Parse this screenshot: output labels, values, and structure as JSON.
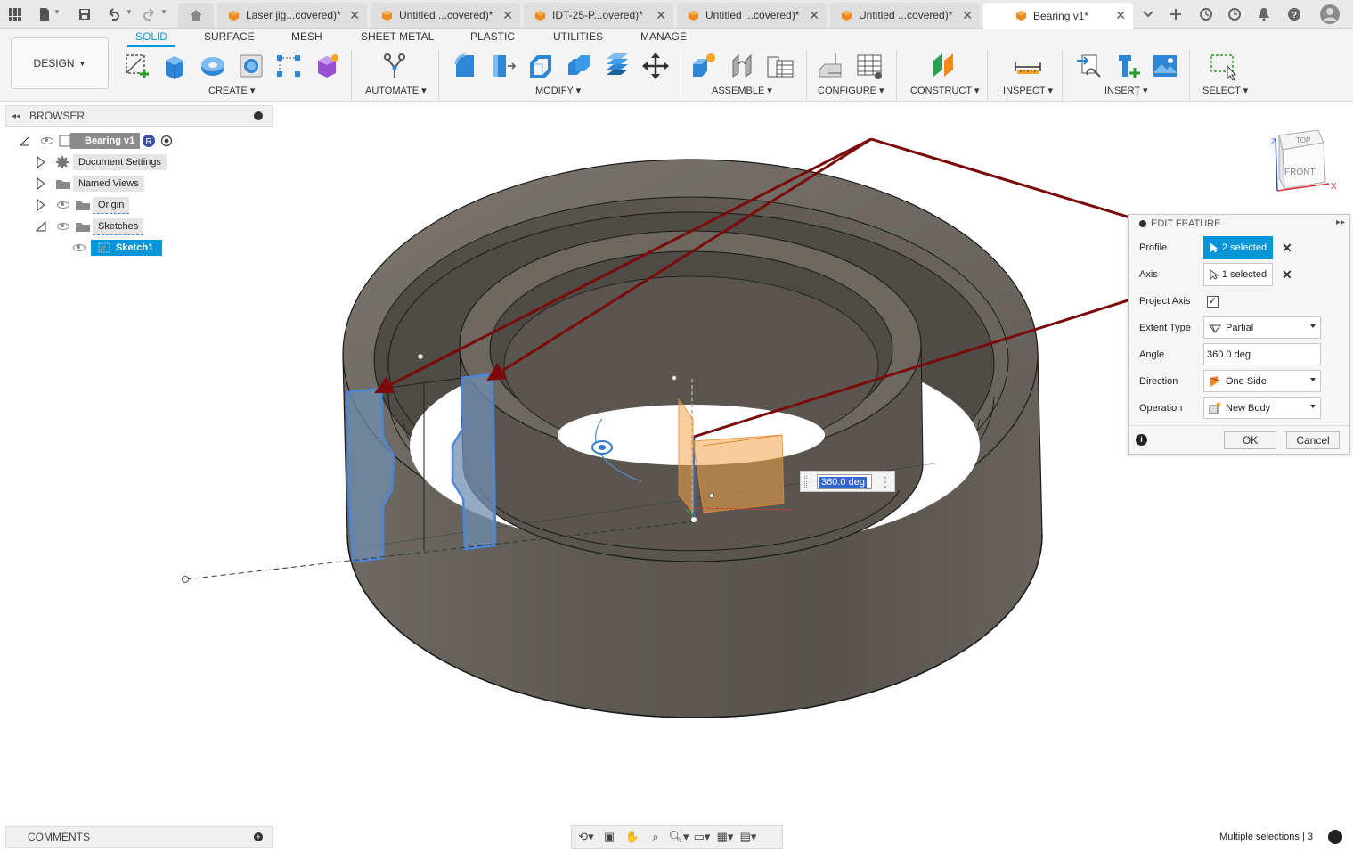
{
  "tabs": {
    "items": [
      {
        "label": "Laser jig...covered)*"
      },
      {
        "label": "Untitled ...covered)*"
      },
      {
        "label": "IDT-25-P...overed)*"
      },
      {
        "label": "Untitled ...covered)*"
      },
      {
        "label": "Untitled ...covered)*"
      },
      {
        "label": "Bearing v1*"
      }
    ]
  },
  "toolbar": {
    "workspace": "DESIGN",
    "tabs": [
      "SOLID",
      "SURFACE",
      "MESH",
      "SHEET METAL",
      "PLASTIC",
      "UTILITIES",
      "MANAGE"
    ],
    "groups": [
      "CREATE",
      "AUTOMATE",
      "MODIFY",
      "ASSEMBLE",
      "CONFIGURE",
      "CONSTRUCT",
      "INSPECT",
      "INSERT",
      "SELECT"
    ]
  },
  "browser": {
    "title": "BROWSER",
    "root": "Bearing v1",
    "items": [
      "Document Settings",
      "Named Views",
      "Origin",
      "Sketches"
    ],
    "child": "Sketch1"
  },
  "dialog": {
    "title": "EDIT FEATURE",
    "profile_label": "Profile",
    "profile_value": "2 selected",
    "axis_label": "Axis",
    "axis_value": "1 selected",
    "project_axis_label": "Project Axis",
    "extent_label": "Extent Type",
    "extent_value": "Partial",
    "angle_label": "Angle",
    "angle_value": "360.0 deg",
    "direction_label": "Direction",
    "direction_value": "One Side",
    "operation_label": "Operation",
    "operation_value": "New Body",
    "ok_label": "OK",
    "cancel_label": "Cancel"
  },
  "canvas": {
    "angle_input": "360.0 deg",
    "viewcube": {
      "top": "TOP",
      "front": "FRONT",
      "x": "X",
      "z": "Z"
    }
  },
  "bottom": {
    "comments": "COMMENTS",
    "status": "Multiple selections | 3"
  },
  "colors": {
    "accent": "#0696d7",
    "annotation_arrow": "#7b0a0a",
    "body": "#5d5a54"
  }
}
